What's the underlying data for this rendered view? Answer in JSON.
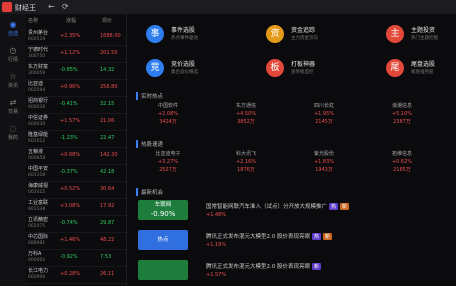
{
  "app": {
    "title": "财经王"
  },
  "nav": {
    "back": "←",
    "refresh": "⟳",
    "items": [
      {
        "label": "自选",
        "icon": "◉",
        "active": true
      },
      {
        "label": "行情",
        "icon": "◷",
        "active": false
      },
      {
        "label": "资讯",
        "icon": "☆",
        "active": false
      },
      {
        "label": "交易",
        "icon": "⇄",
        "active": false
      },
      {
        "label": "我的",
        "icon": "◌",
        "active": false
      }
    ]
  },
  "stock_panel": {
    "headers": [
      "名称",
      "涨幅",
      "现价"
    ],
    "rows": [
      {
        "name": "贵州茅台",
        "code": "600519",
        "pct": "+2.35%",
        "val": "1688.00",
        "dir": "up"
      },
      {
        "name": "宁德时代",
        "code": "300750",
        "pct": "+1.12%",
        "val": "201.50",
        "dir": "up"
      },
      {
        "name": "东方财富",
        "code": "300059",
        "pct": "-0.85%",
        "val": "14.32",
        "dir": "dn"
      },
      {
        "name": "比亚迪",
        "code": "002594",
        "pct": "+0.96%",
        "val": "256.80",
        "dir": "up"
      },
      {
        "name": "招商银行",
        "code": "600036",
        "pct": "-0.41%",
        "val": "32.15",
        "dir": "dn"
      },
      {
        "name": "中信证券",
        "code": "600030",
        "pct": "+1.57%",
        "val": "21.06",
        "dir": "up"
      },
      {
        "name": "隆基绿能",
        "code": "601012",
        "pct": "-1.23%",
        "val": "22.47",
        "dir": "dn"
      },
      {
        "name": "五粮液",
        "code": "000858",
        "pct": "+0.68%",
        "val": "142.30",
        "dir": "up"
      },
      {
        "name": "中国平安",
        "code": "601318",
        "pct": "-0.37%",
        "val": "42.18",
        "dir": "dn"
      },
      {
        "name": "海康威视",
        "code": "002415",
        "pct": "+0.52%",
        "val": "30.64",
        "dir": "up"
      },
      {
        "name": "工业富联",
        "code": "601138",
        "pct": "+3.08%",
        "val": "17.92",
        "dir": "up"
      },
      {
        "name": "立讯精密",
        "code": "002475",
        "pct": "-0.74%",
        "val": "29.87",
        "dir": "dn"
      },
      {
        "name": "中芯国际",
        "code": "688981",
        "pct": "+1.46%",
        "val": "48.22",
        "dir": "up"
      },
      {
        "name": "万科A",
        "code": "000002",
        "pct": "-0.92%",
        "val": "7.53",
        "dir": "dn"
      },
      {
        "name": "长江电力",
        "code": "600900",
        "pct": "+0.28%",
        "val": "26.11",
        "dir": "up"
      }
    ]
  },
  "tiles": [
    {
      "glyph": "事",
      "title": "事件选股",
      "sub": "热点事件驱动",
      "color": "#2f7ef0"
    },
    {
      "glyph": "资",
      "title": "资金追踪",
      "sub": "主力资金流向",
      "color": "#e49a19"
    },
    {
      "glyph": "主",
      "title": "主题投资",
      "sub": "热门主题挖掘",
      "color": "#e2493b"
    },
    {
      "glyph": "竞",
      "title": "竞价选股",
      "sub": "集合竞价精选",
      "color": "#2f7ef0"
    },
    {
      "glyph": "板",
      "title": "打板神器",
      "sub": "涨停板监控",
      "color": "#e2493b"
    },
    {
      "glyph": "尾",
      "title": "尾盘选股",
      "sub": "尾盘强势股",
      "color": "#e2493b"
    }
  ],
  "sections": {
    "hot": "实时热点",
    "bright": "热股速递",
    "news": "最新机会"
  },
  "hot_cols": [
    {
      "a": "中国软件",
      "b": "+2.08%",
      "c": "3424万",
      "dir": "up"
    },
    {
      "a": "东方通信",
      "b": "+4.50%",
      "c": "3852万",
      "dir": "up"
    },
    {
      "a": "四川长虹",
      "b": "+1.95%",
      "c": "2145万",
      "dir": "up"
    },
    {
      "a": "浪潮信息",
      "b": "+5.10%",
      "c": "2387万",
      "dir": "up"
    }
  ],
  "bright_cols": [
    {
      "a": "比亚迪电子",
      "b": "+3.27%",
      "c": "2527万",
      "dir": "up"
    },
    {
      "a": "科大讯飞",
      "b": "+2.16%",
      "c": "1876万",
      "dir": "up"
    },
    {
      "a": "紫光股份",
      "b": "+1.83%",
      "c": "1943万",
      "dir": "up"
    },
    {
      "a": "拓维信息",
      "b": "+0.62%",
      "c": "2185万",
      "dir": "up"
    }
  ],
  "news": [
    {
      "badge1": "车联网",
      "badge2": "-0.90%",
      "text": "国常智能网联汽车准入（试点）分开放大规模推广",
      "sub": "+1.48%",
      "tags": [
        "热",
        "新"
      ],
      "blue": false
    },
    {
      "badge1": "热点",
      "badge2": "",
      "text": "腾讯正式发布混元大模型2.0 股价表现亮眼",
      "sub": "+1.19%",
      "tags": [
        "热",
        "新"
      ],
      "blue": true
    },
    {
      "badge1": "",
      "badge2": "",
      "text": "腾讯正式发布混元大模型2.0 股价表现亮眼",
      "sub": "+1.57%",
      "tags": [
        "新"
      ],
      "blue": false
    }
  ]
}
